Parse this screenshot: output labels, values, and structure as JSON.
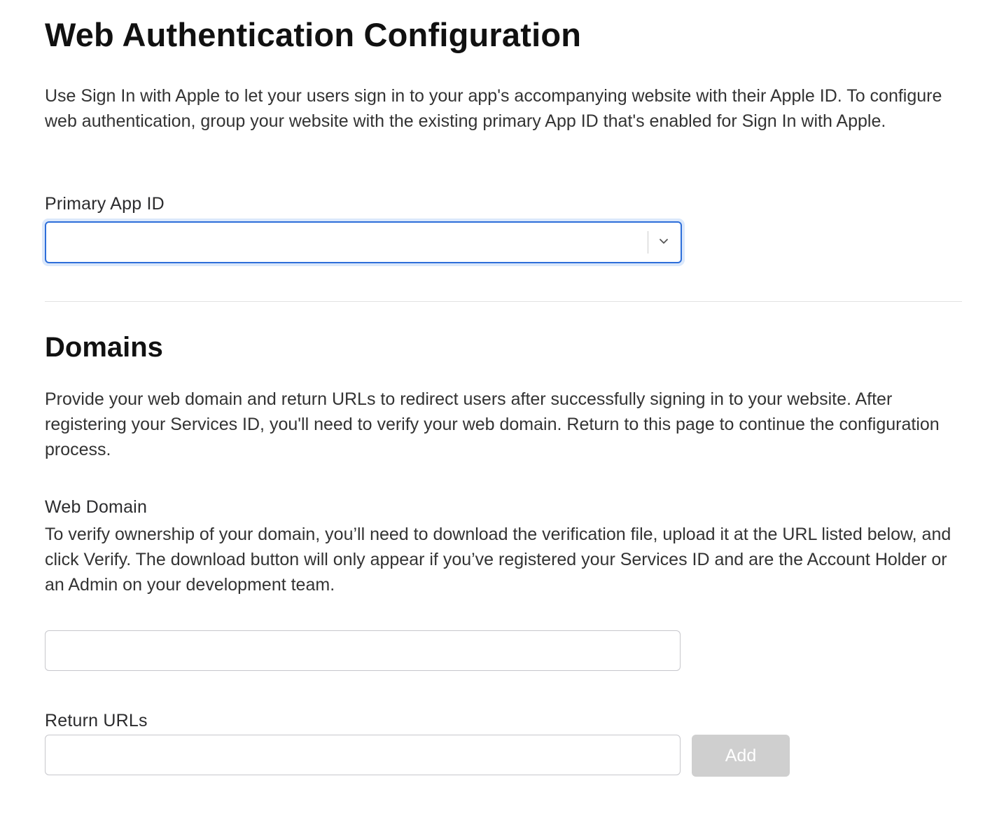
{
  "page": {
    "title": "Web Authentication Configuration",
    "intro": "Use Sign In with Apple to let your users sign in to your app's accompanying website with their Apple ID. To configure web authentication, group your website with the existing primary App ID that's enabled for Sign In with Apple."
  },
  "primary_app_id": {
    "label": "Primary App ID",
    "selected_value": "",
    "chevron_icon": "chevron-down-icon"
  },
  "domains": {
    "heading": "Domains",
    "description": "Provide your web domain and return URLs to redirect users after successfully signing in to your website. After registering your Services ID, you'll need to verify your web domain. Return to this page to continue the configuration process.",
    "web_domain": {
      "label": "Web Domain",
      "help": "To verify ownership of your domain, you’ll need to download the verification file, upload it at the URL listed below, and click Verify. The download button will only appear if you’ve registered your Services ID and are the Account Holder or an Admin on your development team.",
      "value": ""
    },
    "return_urls": {
      "label": "Return URLs",
      "value": "",
      "add_label": "Add"
    }
  },
  "colors": {
    "focus_border": "#2d6ed9",
    "disabled_button": "#cfcfcf"
  }
}
